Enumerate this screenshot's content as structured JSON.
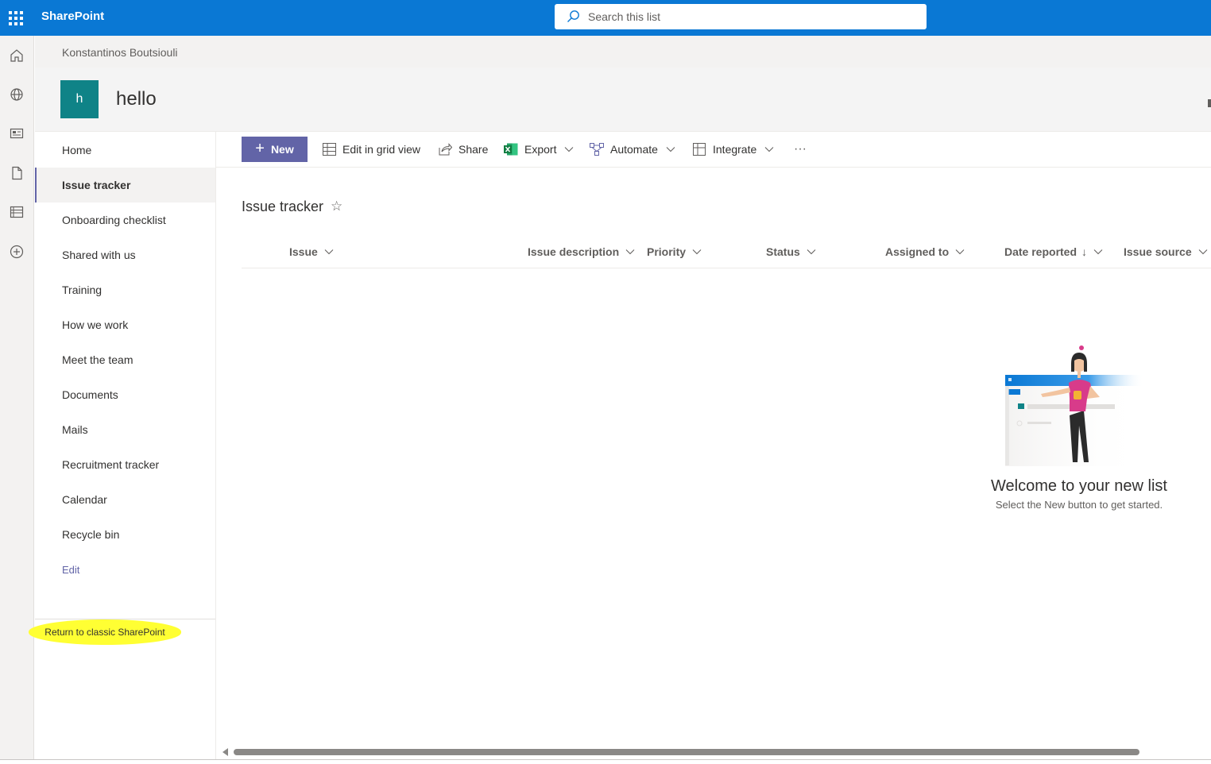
{
  "suite": {
    "brand": "SharePoint",
    "search_placeholder": "Search this list",
    "accent": "#0a78d4"
  },
  "appbar": {
    "icons": [
      "home-icon",
      "globe-icon",
      "news-icon",
      "document-icon",
      "list-icon",
      "add-icon"
    ]
  },
  "site": {
    "breadcrumb": "Konstantinos Boutsiouli",
    "logo_letter": "h",
    "title": "hello",
    "logo_color": "#0f8387"
  },
  "nav": {
    "items": [
      {
        "label": "Home"
      },
      {
        "label": "Issue tracker",
        "selected": true
      },
      {
        "label": "Onboarding checklist"
      },
      {
        "label": "Shared with us"
      },
      {
        "label": "Training"
      },
      {
        "label": "How we work"
      },
      {
        "label": "Meet the team"
      },
      {
        "label": "Documents"
      },
      {
        "label": "Mails"
      },
      {
        "label": "Recruitment tracker"
      },
      {
        "label": "Calendar"
      },
      {
        "label": "Recycle bin"
      }
    ],
    "edit_label": "Edit",
    "classic_label": "Return to classic SharePoint"
  },
  "commandbar": {
    "new_label": "New",
    "edit_grid_label": "Edit in grid view",
    "share_label": "Share",
    "export_label": "Export",
    "automate_label": "Automate",
    "integrate_label": "Integrate",
    "more_label": "···",
    "primary_color": "#6264a7"
  },
  "list": {
    "title": "Issue tracker",
    "columns": [
      {
        "label": "Issue"
      },
      {
        "label": "Issue description"
      },
      {
        "label": "Priority"
      },
      {
        "label": "Status"
      },
      {
        "label": "Assigned to"
      },
      {
        "label": "Date reported",
        "sort": "↓"
      },
      {
        "label": "Issue source"
      }
    ]
  },
  "empty_state": {
    "title": "Welcome to your new list",
    "subtitle": "Select the New button to get started."
  }
}
